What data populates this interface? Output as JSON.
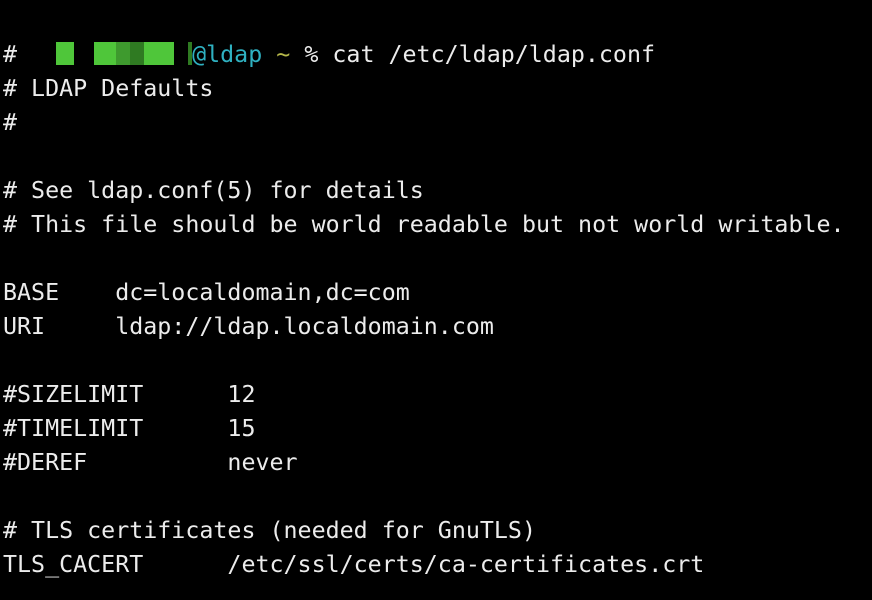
{
  "prompt": {
    "user_redacted": true,
    "at_host": "@ldap",
    "cwd": "~",
    "symbol": "%",
    "command": "cat /etc/ldap/ldap.conf"
  },
  "colors": {
    "background": "#000000",
    "text": "#ececec",
    "host": "#2fb1c1",
    "cwd": "#b6b84a",
    "redaction": "#4fc63a"
  },
  "file_lines": [
    "#",
    "# LDAP Defaults",
    "#",
    "",
    "# See ldap.conf(5) for details",
    "# This file should be world readable but not world writable.",
    "",
    "BASE    dc=localdomain,dc=com",
    "URI     ldap://ldap.localdomain.com",
    "",
    "#SIZELIMIT      12",
    "#TIMELIMIT      15",
    "#DEREF          never",
    "",
    "# TLS certificates (needed for GnuTLS)",
    "TLS_CACERT      /etc/ssl/certs/ca-certificates.crt"
  ]
}
